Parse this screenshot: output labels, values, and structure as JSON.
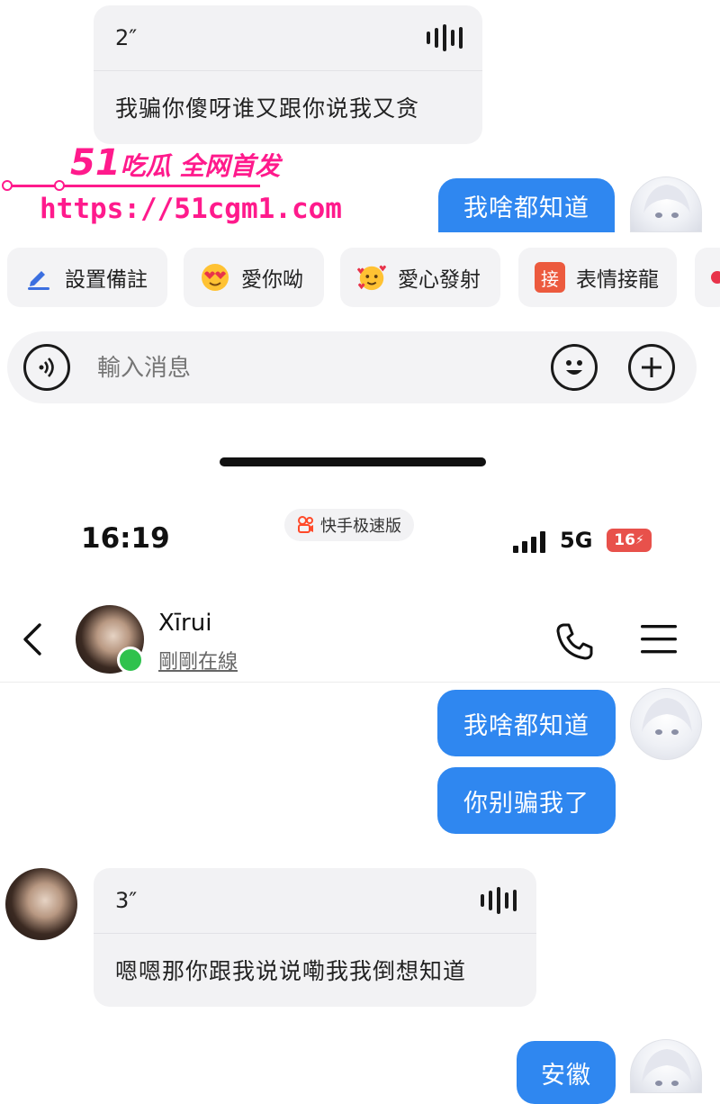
{
  "top_chat": {
    "voice_message": {
      "duration": "2″",
      "text": "我骗你傻呀谁又跟你说我又贪"
    },
    "outgoing_message": "我啥都知道"
  },
  "watermark": {
    "number": "51",
    "slogan": "吃瓜 全网首发",
    "url": "https://51cgm1.com"
  },
  "quick_actions": [
    {
      "label": "設置備註",
      "icon": "pencil-icon"
    },
    {
      "label": "愛你呦",
      "icon": "heart-eyes-emoji-icon"
    },
    {
      "label": "愛心發射",
      "icon": "hearts-emoji-icon"
    },
    {
      "label": "表情接龍",
      "icon": "jie-badge-icon",
      "badge": "接"
    }
  ],
  "input": {
    "placeholder": "輸入消息"
  },
  "status_bar": {
    "time": "16:19",
    "app_label": "快手极速版",
    "network": "5G",
    "battery": "16"
  },
  "header": {
    "contact_name": "Xīrui",
    "status": "剛剛在線"
  },
  "messages": [
    {
      "from": "me",
      "text": "我啥都知道"
    },
    {
      "from": "me",
      "text": "你别骗我了"
    },
    {
      "from": "them",
      "type": "voice",
      "duration": "3″",
      "text": "嗯嗯那你跟我说说嘞我我倒想知道"
    },
    {
      "from": "me",
      "text": "安徽"
    }
  ],
  "colors": {
    "bubble_blue": "#2f87f0",
    "watermark_pink": "#ff1a8c",
    "online_green": "#2fc24d",
    "battery_red": "#e8514b"
  }
}
